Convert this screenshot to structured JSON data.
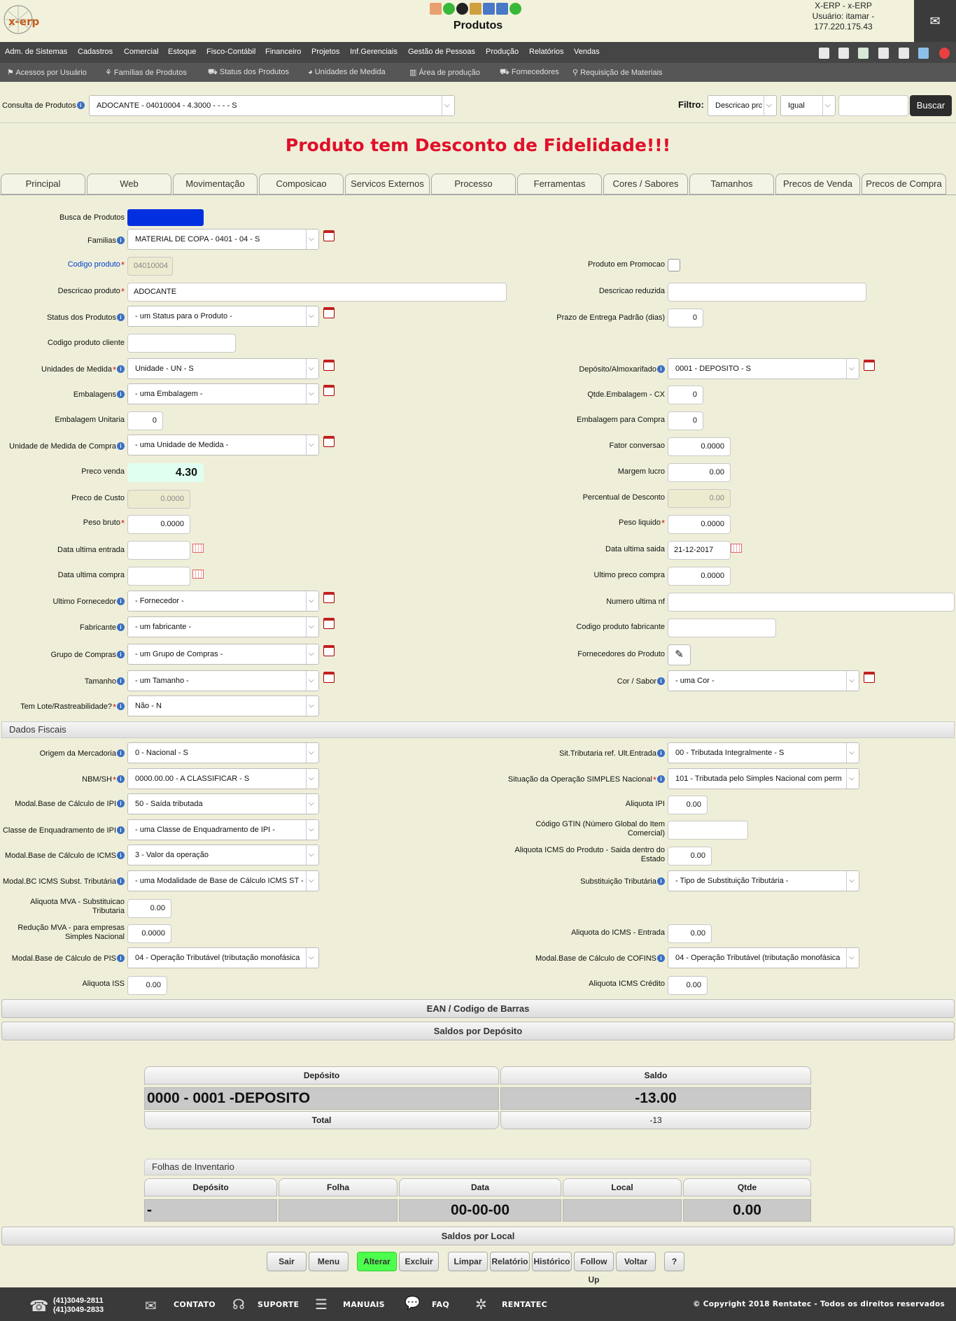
{
  "app": {
    "logo": "x-erp",
    "title": "Produtos",
    "user_line1": "X-ERP - x-ERP",
    "user_line2": "Usuário: itamar -",
    "user_line3": "177.220.175.43"
  },
  "menu": [
    "Adm. de Sistemas",
    "Cadastros",
    "Comercial",
    "Estoque",
    "Fisco-Contábil",
    "Financeiro",
    "Projetos",
    "Inf.Gerenciais",
    "Gestão de Pessoas",
    "Produção",
    "Relatórios",
    "Vendas"
  ],
  "submenu": [
    "Acessos por Usuário",
    "Famílias de Produtos",
    "Status dos Produtos",
    "Unidades de Medida",
    "Área de produção",
    "Fornecedores",
    "Requisição de Materiais"
  ],
  "consulta": {
    "label": "Consulta de Produtos",
    "value": "ADOCANTE - 04010004 - 4.3000 - - - - S",
    "filtro_label": "Filtro:",
    "filtro_field": "Descricao prc",
    "filtro_op": "Igual",
    "filtro_value": "",
    "buscar": "Buscar"
  },
  "alert": "Produto tem Desconto de Fidelidade!!!",
  "tabs": [
    "Principal",
    "Web",
    "Movimentação",
    "Composicao",
    "Servicos Externos",
    "Processo",
    "Ferramentas",
    "Cores / Sabores",
    "Tamanhos",
    "Precos de Venda",
    "Precos de Compra"
  ],
  "form": {
    "busca_label": "Busca de Produtos",
    "familias_label": "Familias",
    "familias": "MATERIAL DE COPA - 0401 - 04 - S",
    "codigo_label": "Codigo produto",
    "codigo": "04010004",
    "promo_label": "Produto em Promocao",
    "descricao_label": "Descricao produto",
    "descricao": "ADOCANTE",
    "desc_red_label": "Descricao reduzida",
    "desc_red": "",
    "status_label": "Status dos Produtos",
    "status": "- um Status para o Produto -",
    "prazo_label": "Prazo de Entrega Padrão (dias)",
    "prazo": "0",
    "cod_cliente_label": "Codigo produto cliente",
    "cod_cliente": "",
    "unidades_label": "Unidades de Medida",
    "unidades": "Unidade - UN - S",
    "deposito_label": "Depósito/Almoxarifado",
    "deposito": "0001 - DEPOSITO - S",
    "embalagens_label": "Embalagens",
    "embalagens": "- uma Embalagem -",
    "qtde_emb_label": "Qtde.Embalagem - CX",
    "qtde_emb": "0",
    "emb_unit_label": "Embalagem Unitaria",
    "emb_unit": "0",
    "emb_compra_label": "Embalagem para Compra",
    "emb_compra": "0",
    "un_compra_label": "Unidade de Medida de Compra",
    "un_compra": "- uma Unidade de Medida -",
    "fator_label": "Fator conversao",
    "fator": "0.0000",
    "preco_venda_label": "Preco venda",
    "preco_venda": "4.30",
    "margem_label": "Margem lucro",
    "margem": "0.00",
    "preco_custo_label": "Preco de Custo",
    "preco_custo": "0.0000",
    "perc_desc_label": "Percentual de Desconto",
    "perc_desc": "0.00",
    "peso_bruto_label": "Peso bruto",
    "peso_bruto": "0.0000",
    "peso_liq_label": "Peso liquido",
    "peso_liq": "0.0000",
    "dt_entrada_label": "Data ultima entrada",
    "dt_entrada": "",
    "dt_saida_label": "Data ultima saida",
    "dt_saida": "21-12-2017",
    "dt_compra_label": "Data ultima compra",
    "dt_compra": "",
    "ult_preco_label": "Ultimo preco compra",
    "ult_preco": "0.0000",
    "ult_forn_label": "Ultimo Fornecedor",
    "ult_forn": "- Fornecedor -",
    "num_nf_label": "Numero ultima nf",
    "num_nf": "",
    "fabricante_label": "Fabricante",
    "fabricante": "- um fabricante -",
    "cod_fab_label": "Codigo produto fabricante",
    "cod_fab": "",
    "grupo_label": "Grupo de Compras",
    "grupo": "- um Grupo de Compras -",
    "forn_prod_label": "Fornecedores do Produto",
    "tamanho_label": "Tamanho",
    "tamanho": "- um Tamanho -",
    "cor_label": "Cor / Sabor",
    "cor": "- uma Cor -",
    "lote_label": "Tem Lote/Rastreabilidade?",
    "lote": "Não - N"
  },
  "fiscal": {
    "title": "Dados Fiscais",
    "origem_label": "Origem da Mercadoria",
    "origem": "0 - Nacional - S",
    "sit_trib_label": "Sit.Tributaria ref. Ult.Entrada",
    "sit_trib": "00 - Tributada Integralmente - S",
    "nbm_label": "NBM/SH",
    "nbm": "0000.00.00 - A CLASSIFICAR - S",
    "simples_label": "Situação da Operação SIMPLES Nacional",
    "simples": "101 - Tributada pelo Simples Nacional com perm",
    "ipi_base_label": "Modal.Base de Cálculo de IPI",
    "ipi_base": "50 - Saída tributada",
    "aliq_ipi_label": "Aliquota IPI",
    "aliq_ipi": "0.00",
    "classe_ipi_label": "Classe de Enquadramento de IPI",
    "classe_ipi": "- uma Classe de Enquadramento de IPI -",
    "gtin_label1": "Código GTIN (Número Global do Item",
    "gtin_label2": "Comercial)",
    "gtin": "",
    "icms_base_label": "Modal.Base de Cálculo de ICMS",
    "icms_base": "3 - Valor da operação",
    "aliq_icms_label1": "Aliquota ICMS do Produto - Saida dentro do",
    "aliq_icms_label2": "Estado",
    "aliq_icms": "0.00",
    "icms_st_label": "Modal.BC ICMS Subst. Tributária",
    "icms_st": "- uma Modalidade de Base de Cálculo ICMS ST -",
    "subst_label": "Substituição Tributária",
    "subst": "- Tipo de Substituição Tributária -",
    "mva_label1": "Aliquota MVA - Substituicao",
    "mva_label2": "Tributaria",
    "mva": "0.00",
    "red_mva_label1": "Redução MVA - para empresas",
    "red_mva_label2": "Simples Nacional",
    "red_mva": "0.0000",
    "aliq_entrada_label": "Aliquota do ICMS - Entrada",
    "aliq_entrada": "0.00",
    "pis_label": "Modal.Base de Cálculo de PIS",
    "pis": "04 - Operação Tributável (tributação monofásica",
    "cofins_label": "Modal.Base de Cálculo de COFINS",
    "cofins": "04 - Operação Tributável (tributação monofásica",
    "iss_label": "Aliquota ISS",
    "iss": "0.00",
    "icms_cred_label": "Aliquota ICMS Crédito",
    "icms_cred": "0.00"
  },
  "sections": {
    "ean": "EAN / Codigo de Barras",
    "saldos_dep": "Saldos por Depósito",
    "saldos_local": "Saldos por Local"
  },
  "saldos": {
    "h_deposito": "Depósito",
    "h_saldo": "Saldo",
    "deposito": "0000 - 0001 -DEPOSITO",
    "saldo": "-13.00",
    "total_label": "Total",
    "total": "-13"
  },
  "inventario": {
    "title": "Folhas de Inventario",
    "headers": [
      "Depósito",
      "Folha",
      "Data",
      "Local",
      "Qtde"
    ],
    "row": [
      "-",
      "",
      "00-00-00",
      "",
      "0.00"
    ]
  },
  "buttons": [
    "Sair",
    "Menu",
    "Alterar",
    "Excluir",
    "Limpar",
    "Relatório",
    "Histórico",
    "Follow Up",
    "Voltar",
    "?"
  ],
  "footer": {
    "phone1": "(41)3049-2811",
    "phone2": "(41)3049-2833",
    "contato": "CONTATO",
    "suporte": "SUPORTE",
    "manuais": "MANUAIS",
    "faq": "FAQ",
    "rentatec": "RENTATEC",
    "copyright": "© Copyright 2018 Rentatec - Todos os direitos reservados"
  },
  "colors": {
    "alert": "#e0102a",
    "accent": "#0030e0",
    "green": "#4dff4d"
  }
}
